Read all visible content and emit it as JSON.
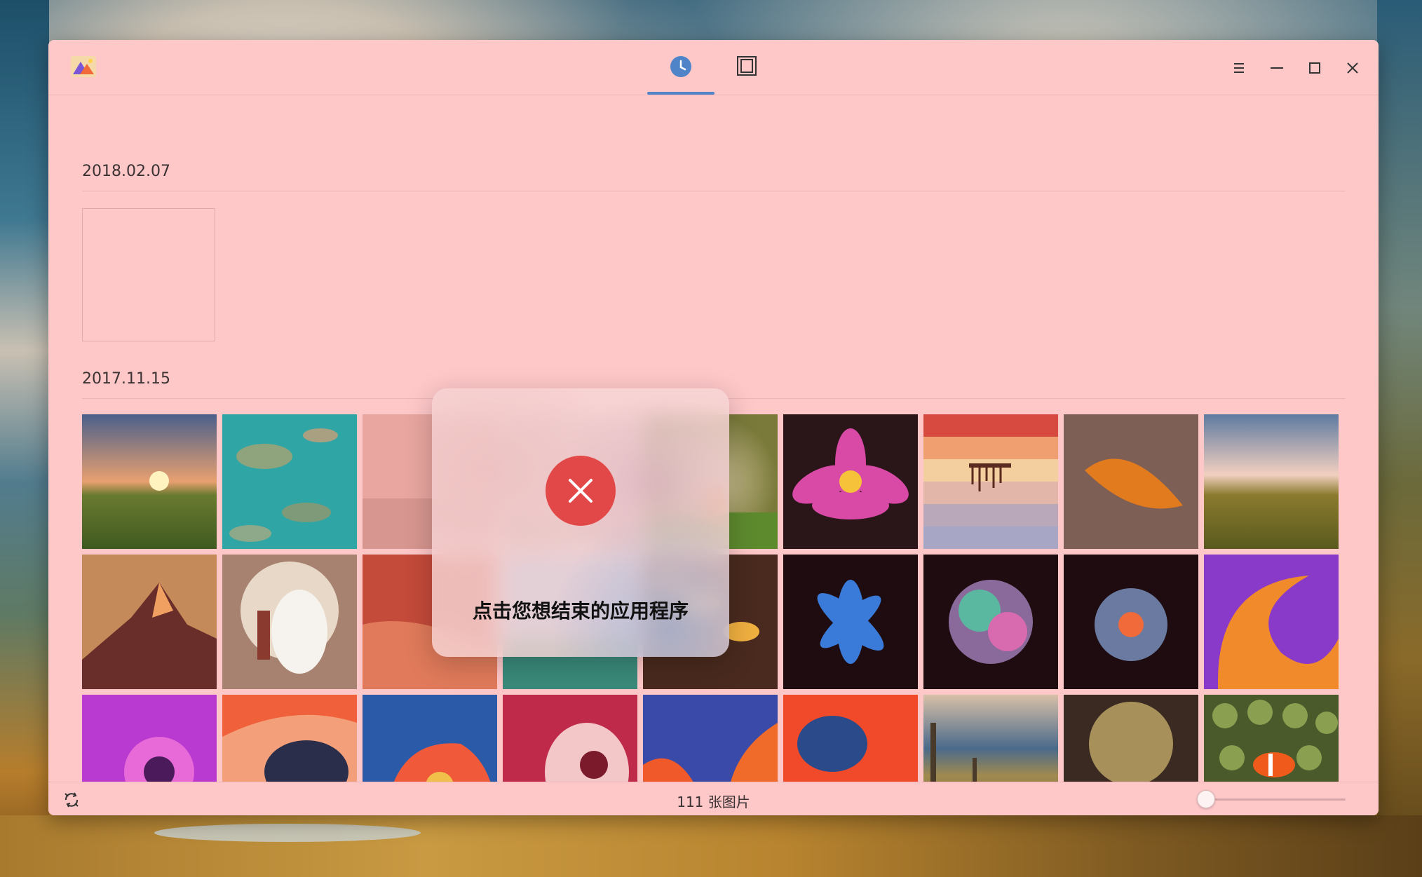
{
  "window": {
    "tabs": [
      {
        "name": "timeline-tab",
        "icon": "clock-icon",
        "active": true
      },
      {
        "name": "albums-tab",
        "icon": "album-icon",
        "active": false
      }
    ],
    "controls": [
      "menu-icon",
      "minimize-icon",
      "maximize-icon",
      "close-icon"
    ]
  },
  "sections": [
    {
      "date": "2018.02.07",
      "count": 1
    },
    {
      "date": "2017.11.15",
      "count": 27
    }
  ],
  "status": {
    "photo_count": "111 张图片",
    "zoom_level": 0
  },
  "overlay": {
    "message": "点击您想结束的应用程序",
    "icon": "close-x-icon",
    "accent": "#e34848"
  },
  "colors": {
    "window_bg": "#fec7c8",
    "tab_accent": "#4f84c9"
  }
}
